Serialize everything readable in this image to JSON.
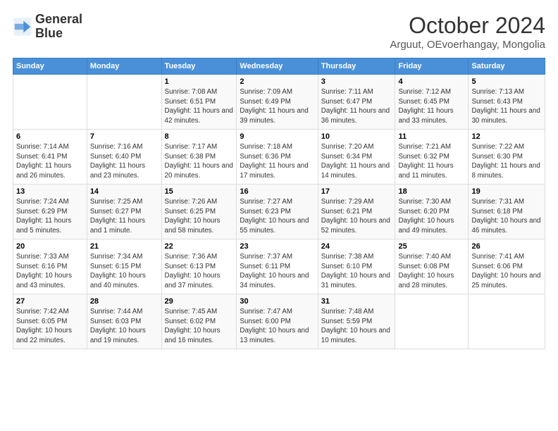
{
  "logo": {
    "line1": "General",
    "line2": "Blue"
  },
  "title": "October 2024",
  "subtitle": "Arguut, OEvoerhangay, Mongolia",
  "weekdays": [
    "Sunday",
    "Monday",
    "Tuesday",
    "Wednesday",
    "Thursday",
    "Friday",
    "Saturday"
  ],
  "weeks": [
    [
      {
        "day": "",
        "info": ""
      },
      {
        "day": "",
        "info": ""
      },
      {
        "day": "1",
        "info": "Sunrise: 7:08 AM\nSunset: 6:51 PM\nDaylight: 11 hours and 42 minutes."
      },
      {
        "day": "2",
        "info": "Sunrise: 7:09 AM\nSunset: 6:49 PM\nDaylight: 11 hours and 39 minutes."
      },
      {
        "day": "3",
        "info": "Sunrise: 7:11 AM\nSunset: 6:47 PM\nDaylight: 11 hours and 36 minutes."
      },
      {
        "day": "4",
        "info": "Sunrise: 7:12 AM\nSunset: 6:45 PM\nDaylight: 11 hours and 33 minutes."
      },
      {
        "day": "5",
        "info": "Sunrise: 7:13 AM\nSunset: 6:43 PM\nDaylight: 11 hours and 30 minutes."
      }
    ],
    [
      {
        "day": "6",
        "info": "Sunrise: 7:14 AM\nSunset: 6:41 PM\nDaylight: 11 hours and 26 minutes."
      },
      {
        "day": "7",
        "info": "Sunrise: 7:16 AM\nSunset: 6:40 PM\nDaylight: 11 hours and 23 minutes."
      },
      {
        "day": "8",
        "info": "Sunrise: 7:17 AM\nSunset: 6:38 PM\nDaylight: 11 hours and 20 minutes."
      },
      {
        "day": "9",
        "info": "Sunrise: 7:18 AM\nSunset: 6:36 PM\nDaylight: 11 hours and 17 minutes."
      },
      {
        "day": "10",
        "info": "Sunrise: 7:20 AM\nSunset: 6:34 PM\nDaylight: 11 hours and 14 minutes."
      },
      {
        "day": "11",
        "info": "Sunrise: 7:21 AM\nSunset: 6:32 PM\nDaylight: 11 hours and 11 minutes."
      },
      {
        "day": "12",
        "info": "Sunrise: 7:22 AM\nSunset: 6:30 PM\nDaylight: 11 hours and 8 minutes."
      }
    ],
    [
      {
        "day": "13",
        "info": "Sunrise: 7:24 AM\nSunset: 6:29 PM\nDaylight: 11 hours and 5 minutes."
      },
      {
        "day": "14",
        "info": "Sunrise: 7:25 AM\nSunset: 6:27 PM\nDaylight: 11 hours and 1 minute."
      },
      {
        "day": "15",
        "info": "Sunrise: 7:26 AM\nSunset: 6:25 PM\nDaylight: 10 hours and 58 minutes."
      },
      {
        "day": "16",
        "info": "Sunrise: 7:27 AM\nSunset: 6:23 PM\nDaylight: 10 hours and 55 minutes."
      },
      {
        "day": "17",
        "info": "Sunrise: 7:29 AM\nSunset: 6:21 PM\nDaylight: 10 hours and 52 minutes."
      },
      {
        "day": "18",
        "info": "Sunrise: 7:30 AM\nSunset: 6:20 PM\nDaylight: 10 hours and 49 minutes."
      },
      {
        "day": "19",
        "info": "Sunrise: 7:31 AM\nSunset: 6:18 PM\nDaylight: 10 hours and 46 minutes."
      }
    ],
    [
      {
        "day": "20",
        "info": "Sunrise: 7:33 AM\nSunset: 6:16 PM\nDaylight: 10 hours and 43 minutes."
      },
      {
        "day": "21",
        "info": "Sunrise: 7:34 AM\nSunset: 6:15 PM\nDaylight: 10 hours and 40 minutes."
      },
      {
        "day": "22",
        "info": "Sunrise: 7:36 AM\nSunset: 6:13 PM\nDaylight: 10 hours and 37 minutes."
      },
      {
        "day": "23",
        "info": "Sunrise: 7:37 AM\nSunset: 6:11 PM\nDaylight: 10 hours and 34 minutes."
      },
      {
        "day": "24",
        "info": "Sunrise: 7:38 AM\nSunset: 6:10 PM\nDaylight: 10 hours and 31 minutes."
      },
      {
        "day": "25",
        "info": "Sunrise: 7:40 AM\nSunset: 6:08 PM\nDaylight: 10 hours and 28 minutes."
      },
      {
        "day": "26",
        "info": "Sunrise: 7:41 AM\nSunset: 6:06 PM\nDaylight: 10 hours and 25 minutes."
      }
    ],
    [
      {
        "day": "27",
        "info": "Sunrise: 7:42 AM\nSunset: 6:05 PM\nDaylight: 10 hours and 22 minutes."
      },
      {
        "day": "28",
        "info": "Sunrise: 7:44 AM\nSunset: 6:03 PM\nDaylight: 10 hours and 19 minutes."
      },
      {
        "day": "29",
        "info": "Sunrise: 7:45 AM\nSunset: 6:02 PM\nDaylight: 10 hours and 16 minutes."
      },
      {
        "day": "30",
        "info": "Sunrise: 7:47 AM\nSunset: 6:00 PM\nDaylight: 10 hours and 13 minutes."
      },
      {
        "day": "31",
        "info": "Sunrise: 7:48 AM\nSunset: 5:59 PM\nDaylight: 10 hours and 10 minutes."
      },
      {
        "day": "",
        "info": ""
      },
      {
        "day": "",
        "info": ""
      }
    ]
  ]
}
